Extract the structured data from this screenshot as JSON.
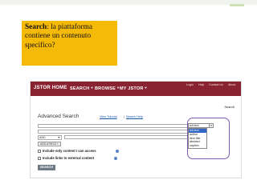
{
  "slide": {
    "callout": {
      "bold": "Search",
      "rest": ": la piattaforma contiene un contenuto specifico?"
    }
  },
  "jstor": {
    "brand": "JSTOR HOME",
    "nav": [
      "SEARCH",
      "BROWSE",
      "MY JSTOR"
    ],
    "top_links": [
      "Login",
      "Help",
      "Contact Us",
      "About"
    ],
    "search_link": "Search",
    "title": "Advanced Search",
    "help_links": [
      "View Tutorial",
      "Search Help"
    ],
    "operator": "AND",
    "add_field": "ADD A FIELD +",
    "checkboxes": [
      "Include only content I can access",
      "Include links to external content"
    ],
    "search_button": "SEARCH",
    "field_select": {
      "selected": "full-text",
      "options": [
        "full-text",
        "author",
        "item title",
        "abstract",
        "caption"
      ],
      "active_index": 0
    }
  },
  "colors": {
    "callout_bg": "#f5b908",
    "jstor_bar": "#8a2331",
    "highlight_ring": "#7f59ad",
    "active_option": "#3166c6"
  }
}
